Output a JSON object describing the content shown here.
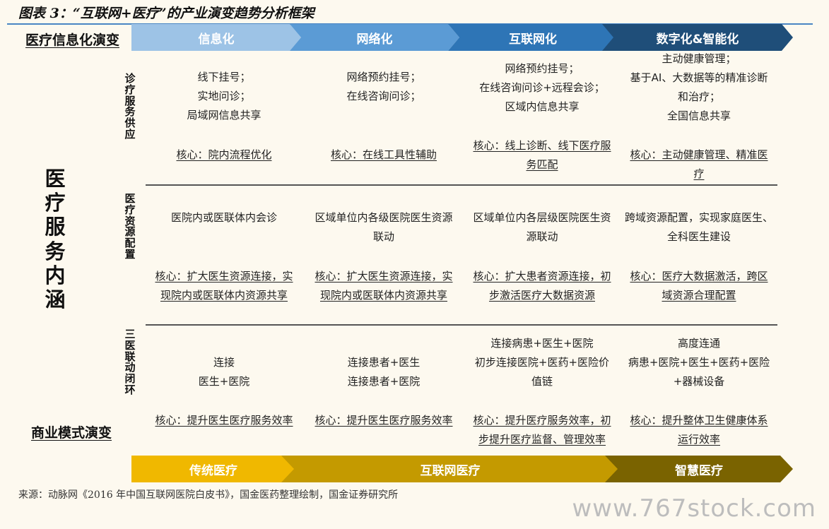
{
  "figure_title": "图表 3：“互联网+医疗”的产业演变趋势分析框架",
  "left_labels": {
    "info_evolution": "医疗信息化演变",
    "service_content": "医疗服务内涵",
    "business_evolution": "商业模式演变"
  },
  "stages": [
    {
      "label": "信息化",
      "color": "#9dc3e6"
    },
    {
      "label": "网络化",
      "color": "#5b9bd5"
    },
    {
      "label": "互联网化",
      "color": "#2e75b6"
    },
    {
      "label": "数字化&智能化",
      "color": "#1f4e79"
    }
  ],
  "sections": [
    {
      "label": "诊疗服务供应",
      "cells": [
        "线下挂号；\n实地问诊；\n局域网信息共享",
        "网络预约挂号；\n在线咨询问诊；",
        "网络预约挂号；\n在线咨询问诊+远程会诊；\n区域内信息共享",
        "主动健康管理；\n基于AI、大数据等的精准诊断\n和治疗；\n全国信息共享"
      ],
      "cores": [
        "核心：院内流程优化",
        "核心：在线工具性辅助",
        "核心：线上诊断、线下医疗服\n务匹配",
        "核心：主动健康管理、精准医\n疗"
      ]
    },
    {
      "label": "医疗资源配置",
      "cells": [
        "医院内或医联体内会诊",
        "区域单位内各级医院医生资源\n联动",
        "区域单位内各层级医院医生资\n源联动",
        "跨域资源配置，实现家庭医生、\n全科医生建设"
      ],
      "cores": [
        "核心：扩大医生资源连接，实\n现院内或医联体内资源共享",
        "核心：扩大医生资源连接，实\n现院内或医联体内资源共享",
        "核心：扩大患者资源连接，初\n步激活医疗大数据资源",
        "核心：医疗大数据激活，跨区\n域资源合理配置"
      ]
    },
    {
      "label": "三医联动闭环",
      "cells": [
        "连接\n医生+医院",
        "连接患者+医生\n连接患者+医院",
        "连接病患+医生+医院\n初步连接医院+医药+医险价\n值链",
        "高度连通\n病患+医院+医生+医药+医险\n+器械设备"
      ],
      "cores": [
        "核心：提升医生医疗服务效率",
        "核心：提升医生医疗服务效率",
        "核心：提升医疗服务效率，初\n步提升医疗监督、管理效率",
        "核心：提升整体卫生健康体系\n运行效率"
      ]
    }
  ],
  "business_models": [
    {
      "label": "传统医疗",
      "color": "#f0b800"
    },
    {
      "label": "互联网医疗",
      "color": "#c49a00"
    },
    {
      "label": "智慧医疗",
      "color": "#7a6300"
    }
  ],
  "source": "来源：动脉网《2016 年中国互联网医院白皮书》，国金医药整理绘制，国金证券研究所",
  "watermark": "www.767stock.com"
}
